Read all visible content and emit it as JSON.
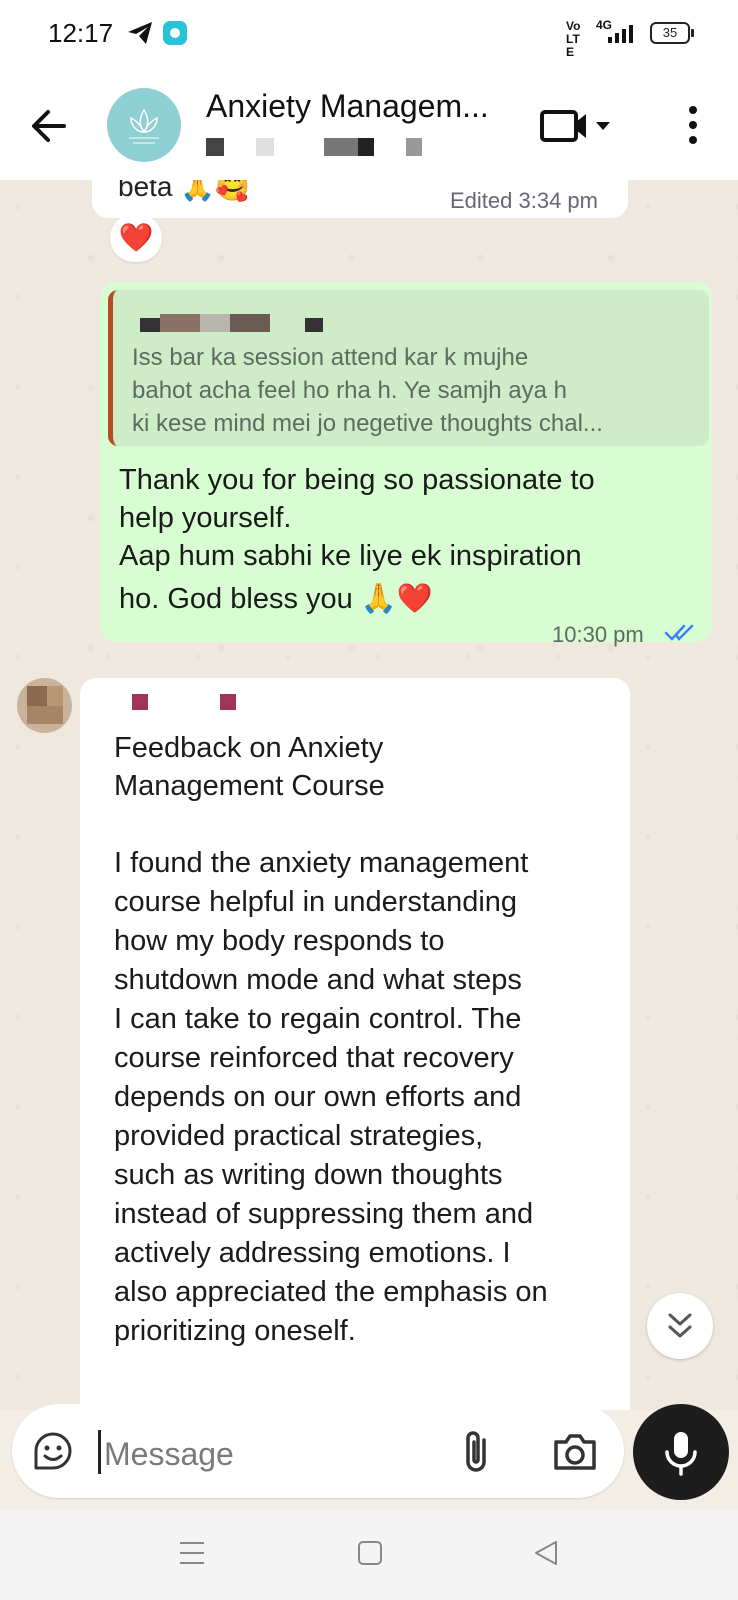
{
  "status_bar": {
    "time": "12:17",
    "network_label": "Vo LTE",
    "network_type": "4G",
    "battery": "35",
    "icons": [
      "telegram-icon",
      "app-notification-icon",
      "signal-icon",
      "battery-icon"
    ]
  },
  "header": {
    "title": "Anxiety Managem...",
    "icons": [
      "back-arrow-icon",
      "video-call-icon",
      "dropdown-icon",
      "more-vert-icon"
    ]
  },
  "messages": [
    {
      "type": "incoming",
      "visible_text": "beta",
      "emoji": "🙏🥰",
      "time": "Edited 3:34 pm",
      "reaction": "❤️"
    },
    {
      "type": "outgoing",
      "quote_lines": [
        "Iss bar ka session attend kar k mujhe",
        "bahot acha feel ho rha h. Ye samjh aya h",
        "ki kese mind mei jo negetive thoughts chal..."
      ],
      "lines": [
        "Thank you for being so passionate to",
        "help yourself.",
        "Aap hum sabhi ke liye ek inspiration",
        "ho. God bless you 🙏❤️"
      ],
      "time": "10:30 pm",
      "status": "read"
    },
    {
      "type": "incoming",
      "lines": [
        "Feedback on Anxiety",
        "Management Course",
        "",
        "I found the anxiety management",
        "course helpful in understanding",
        "how my body responds to",
        "shutdown mode and what steps",
        "I can take to regain control. The",
        "course reinforced that recovery",
        "depends on our own efforts and",
        "provided practical strategies,",
        "such as writing down thoughts",
        "instead of suppressing them and",
        "actively addressing emotions. I",
        "also appreciated the emphasis on",
        "prioritizing oneself."
      ]
    }
  ],
  "input": {
    "placeholder": "Message",
    "icons": [
      "sticker-icon",
      "attach-icon",
      "camera-icon",
      "mic-icon"
    ]
  },
  "nav": {
    "icons": [
      "menu-nav-icon",
      "home-nav-icon",
      "back-nav-icon"
    ]
  },
  "colors": {
    "outgoing_bubble": "#d9fdd3",
    "incoming_bubble": "#ffffff",
    "chat_background": "#efe8df",
    "read_ticks": "#3b82f6",
    "quote_bar": "#b84b23"
  }
}
